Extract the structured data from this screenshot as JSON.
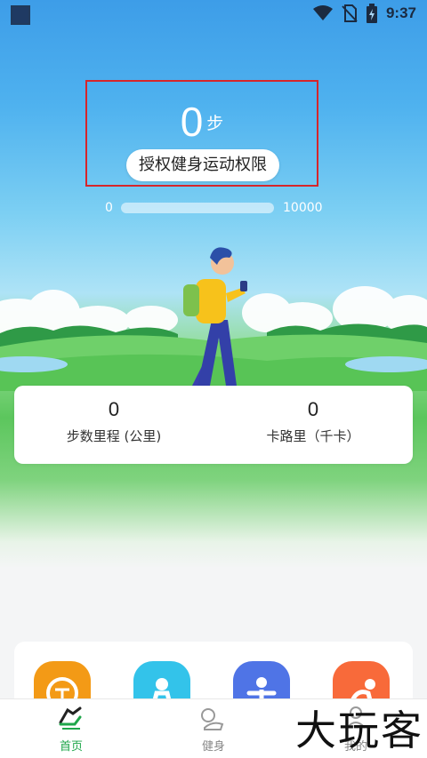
{
  "status_bar": {
    "time": "9:37"
  },
  "steps": {
    "count": "0",
    "unit": "步",
    "auth_button": "授权健身运动权限"
  },
  "progress": {
    "min": "0",
    "max": "10000",
    "fraction": 0
  },
  "stats": [
    {
      "value": "0",
      "label": "步数里程 (公里)"
    },
    {
      "value": "0",
      "label": "卡路里（千卡）"
    }
  ],
  "shortcuts": [
    {
      "icon": "scale-icon",
      "color": "#f39a16"
    },
    {
      "icon": "person-stretch-icon",
      "color": "#33c3ea"
    },
    {
      "icon": "person-exercise-icon",
      "color": "#4f74e6"
    },
    {
      "icon": "person-bend-icon",
      "color": "#f86a3a"
    }
  ],
  "tabs": [
    {
      "label": "首页",
      "icon": "running-shoe-icon"
    },
    {
      "label": "健身",
      "icon": "fitness-icon"
    },
    {
      "label": "我的",
      "icon": "profile-icon"
    }
  ],
  "watermark": "大玩客"
}
